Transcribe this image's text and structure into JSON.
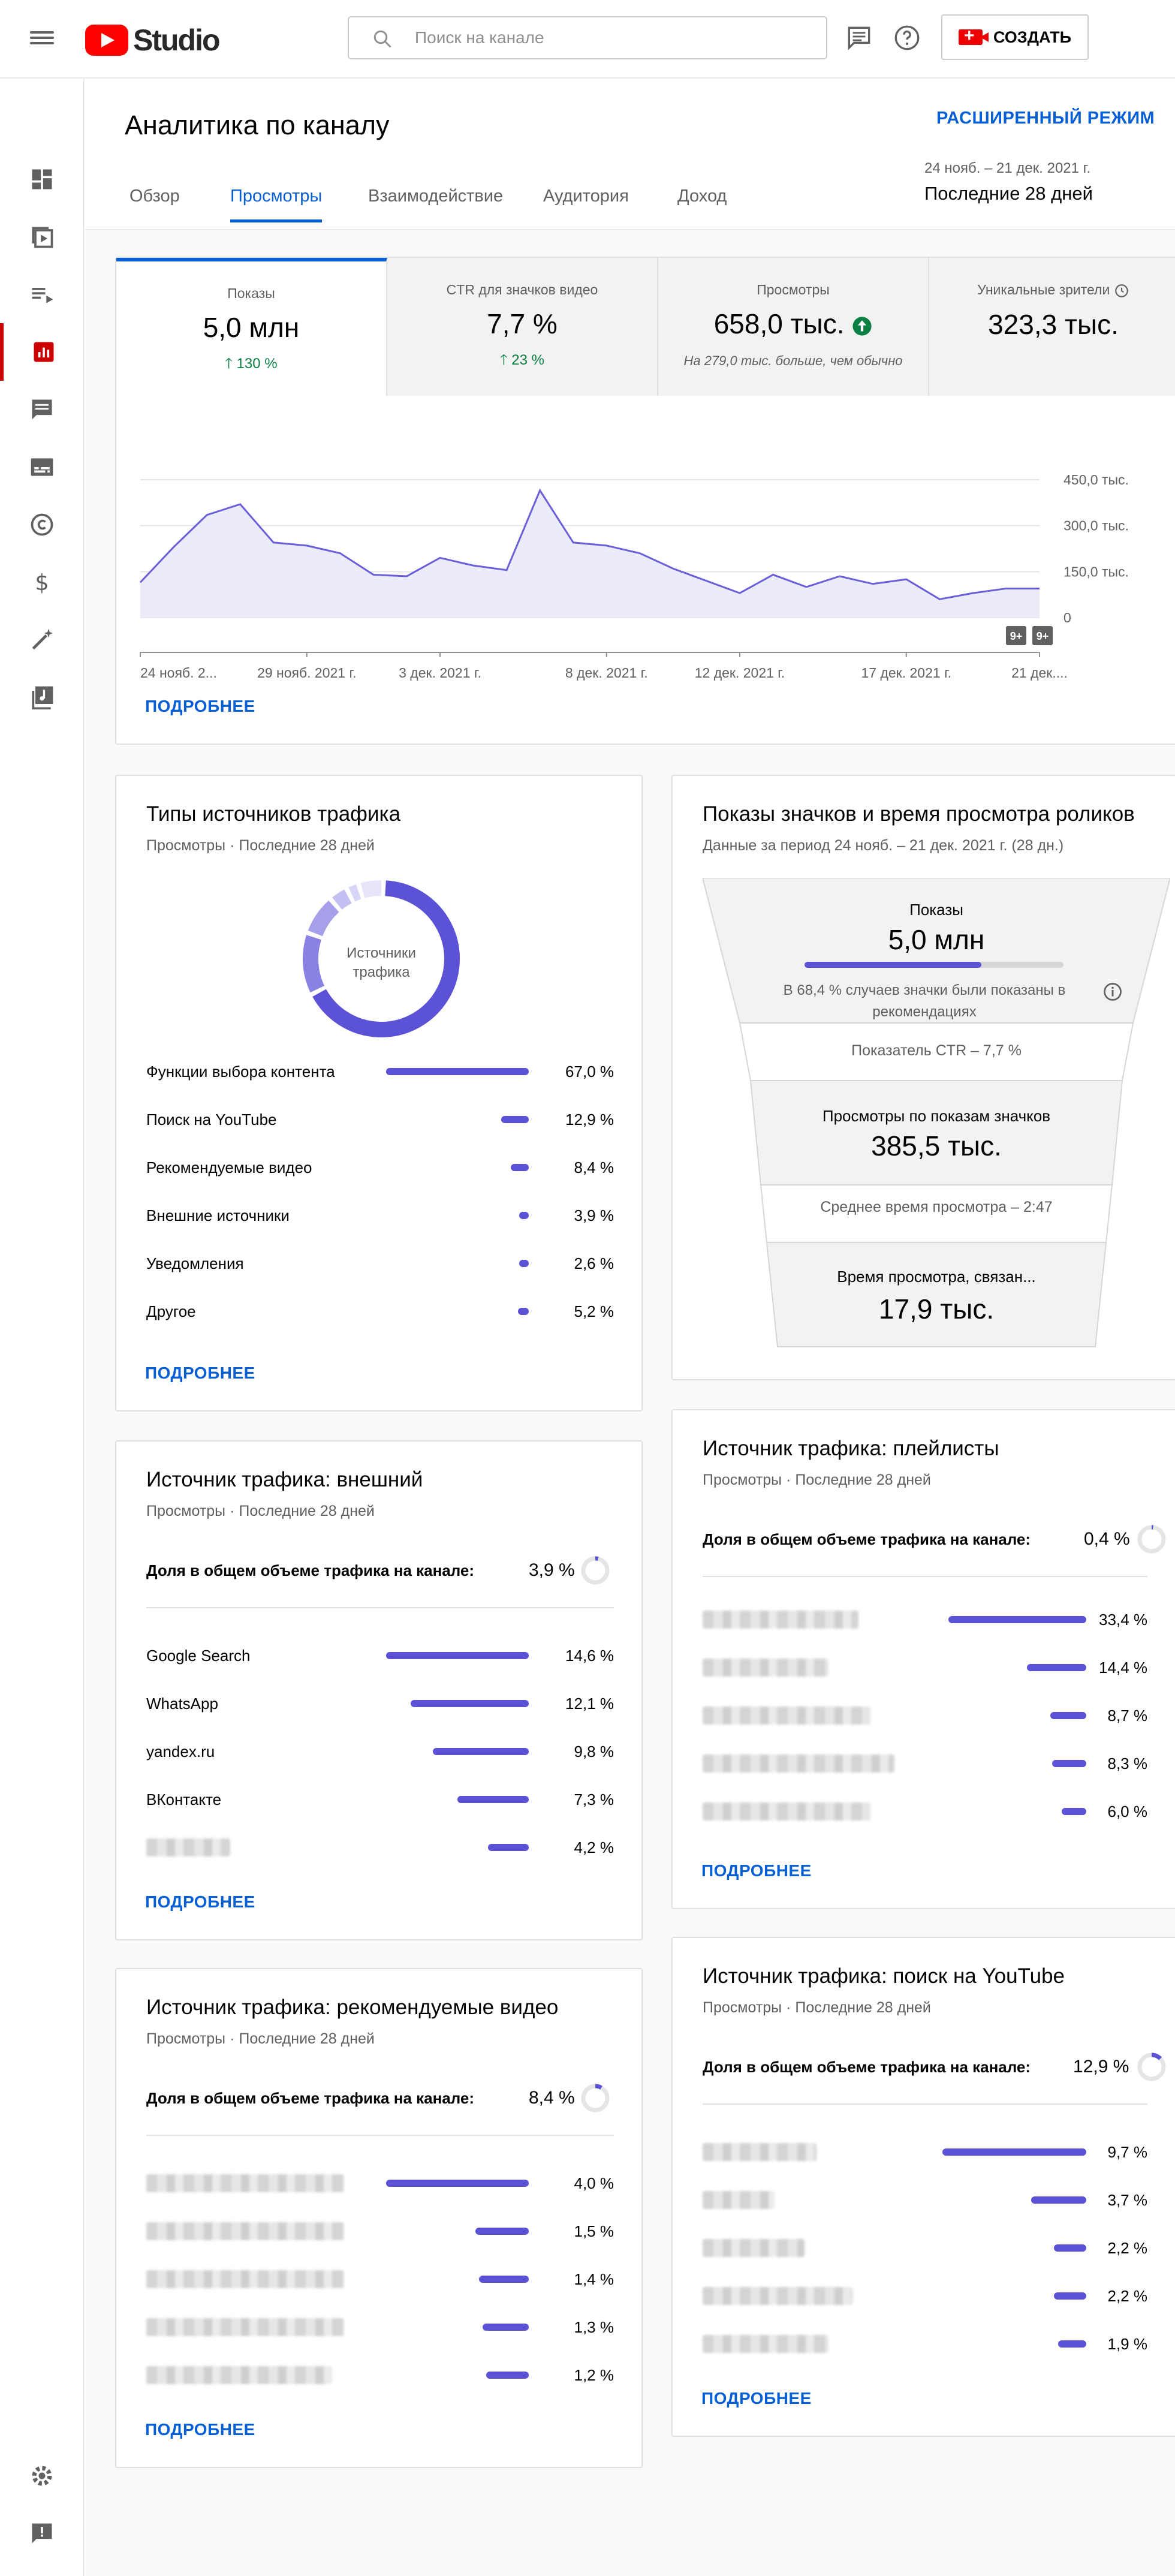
{
  "app": {
    "title": "Studio",
    "search_placeholder": "Поиск на канале",
    "create_label": "СОЗДАТЬ"
  },
  "page": {
    "title": "Аналитика по каналу",
    "advanced_mode": "РАСШИРЕННЫЙ РЕЖИМ",
    "tabs": [
      "Обзор",
      "Просмотры",
      "Взаимодействие",
      "Аудитория",
      "Доход"
    ],
    "active_tab": "Просмотры",
    "date_range": "24 нояб. – 21 дек. 2021 г.",
    "date_preset": "Последние 28 дней"
  },
  "sidebar": {
    "items": [
      "dashboard-icon",
      "content-icon",
      "playlists-icon",
      "analytics-icon",
      "comments-icon",
      "subtitles-icon",
      "copyright-icon",
      "monetization-icon",
      "customization-icon",
      "audio-library-icon",
      "settings-icon",
      "feedback-icon"
    ],
    "active": "analytics-icon"
  },
  "metrics": [
    {
      "label": "Показы",
      "value": "5,0 млн",
      "delta": "130 %"
    },
    {
      "label": "CTR для значков видео",
      "value": "7,7 %",
      "delta": "23 %"
    },
    {
      "label": "Просмотры",
      "value": "658,0 тыс.",
      "note": "На 279,0 тыс. больше, чем обычно"
    },
    {
      "label": "Уникальные зрители",
      "value": "323,3 тыс."
    }
  ],
  "chart_data": {
    "type": "area",
    "title": "",
    "x_ticks": [
      "24 нояб. 2...",
      "29 нояб. 2021 г.",
      "3 дек. 2021 г.",
      "8 дек. 2021 г.",
      "12 дек. 2021 г.",
      "17 дек. 2021 г.",
      "21 дек...."
    ],
    "y_ticks": [
      "450,0 тыс.",
      "300,0 тыс.",
      "150,0 тыс.",
      "0"
    ],
    "ylim": [
      0,
      450000
    ],
    "badges": [
      "9+",
      "9+"
    ],
    "x": [
      "24.11",
      "25.11",
      "26.11",
      "27.11",
      "28.11",
      "29.11",
      "30.11",
      "01.12",
      "02.12",
      "03.12",
      "04.12",
      "05.12",
      "06.12",
      "07.12",
      "08.12",
      "09.12",
      "10.12",
      "11.12",
      "12.12",
      "13.12",
      "14.12",
      "15.12",
      "16.12",
      "17.12",
      "18.12",
      "19.12",
      "20.12",
      "21.12"
    ],
    "values": [
      115000,
      230000,
      335000,
      370000,
      245000,
      235000,
      210000,
      140000,
      135000,
      195000,
      170000,
      155000,
      415000,
      245000,
      235000,
      210000,
      160000,
      120000,
      80000,
      140000,
      100000,
      135000,
      110000,
      125000,
      60000,
      80000,
      95000,
      95000
    ],
    "more": "ПОДРОБНЕЕ"
  },
  "traffic_types": {
    "title": "Типы источников трафика",
    "subtitle": "Просмотры · Последние 28 дней",
    "donut_label": "Источники трафика",
    "rows": [
      {
        "label": "Функции выбора контента",
        "value": "67,0 %",
        "share": 67.0
      },
      {
        "label": "Поиск на YouTube",
        "value": "12,9 %",
        "share": 12.9
      },
      {
        "label": "Рекомендуемые видео",
        "value": "8,4 %",
        "share": 8.4
      },
      {
        "label": "Внешние источники",
        "value": "3,9 %",
        "share": 3.9
      },
      {
        "label": "Уведомления",
        "value": "2,6 %",
        "share": 2.6
      },
      {
        "label": "Другое",
        "value": "5,2 %",
        "share": 5.2
      }
    ],
    "more": "ПОДРОБНЕЕ"
  },
  "funnel": {
    "title": "Показы значков и время просмотра роликов",
    "subtitle": "Данные за период 24 нояб. – 21 дек. 2021 г. (28 дн.)",
    "impressions_label": "Показы",
    "impressions_value": "5,0 млн",
    "impressions_share": 68.4,
    "impressions_note": "В 68,4 % случаев значки были показаны в рекомендациях",
    "ctr_text": "Показатель CTR – 7,7 %",
    "views_label": "Просмотры по показам значков",
    "views_value": "385,5 тыс.",
    "avg_text": "Среднее время просмотра – 2:47",
    "watch_label": "Время просмотра, связан...",
    "watch_value": "17,9 тыс."
  },
  "external": {
    "title": "Источник трафика: внешний",
    "subtitle": "Просмотры · Последние 28 дней",
    "share_label": "Доля в общем объеме трафика на канале:",
    "share_value": "3,9 %",
    "rows": [
      {
        "label": "Google Search",
        "value": "14,6 %",
        "share": 14.6
      },
      {
        "label": "WhatsApp",
        "value": "12,1 %",
        "share": 12.1
      },
      {
        "label": "yandex.ru",
        "value": "9,8 %",
        "share": 9.8
      },
      {
        "label": "ВКонтакте",
        "value": "7,3 %",
        "share": 7.3
      },
      {
        "label": "",
        "value": "4,2 %",
        "share": 4.2
      }
    ],
    "more": "ПОДРОБНЕЕ"
  },
  "playlists": {
    "title": "Источник трафика: плейлисты",
    "subtitle": "Просмотры · Последние 28 дней",
    "share_label": "Доля в общем объеме трафика на канале:",
    "share_value": "0,4 %",
    "rows": [
      {
        "value": "33,4 %",
        "share": 33.4
      },
      {
        "value": "14,4 %",
        "share": 14.4
      },
      {
        "value": "8,7 %",
        "share": 8.7
      },
      {
        "value": "8,3 %",
        "share": 8.3
      },
      {
        "value": "6,0 %",
        "share": 6.0
      }
    ],
    "more": "ПОДРОБНЕЕ"
  },
  "suggested": {
    "title": "Источник трафика: рекомендуемые видео",
    "subtitle": "Просмотры · Последние 28 дней",
    "share_label": "Доля в общем объеме трафика на канале:",
    "share_value": "8,4 %",
    "rows": [
      {
        "value": "4,0 %",
        "share": 4.0
      },
      {
        "value": "1,5 %",
        "share": 1.5
      },
      {
        "value": "1,4 %",
        "share": 1.4
      },
      {
        "value": "1,3 %",
        "share": 1.3
      },
      {
        "value": "1,2 %",
        "share": 1.2
      }
    ],
    "more": "ПОДРОБНЕЕ"
  },
  "yt_search": {
    "title": "Источник трафика: поиск на YouTube",
    "subtitle": "Просмотры · Последние 28 дней",
    "share_label": "Доля в общем объеме трафика на канале:",
    "share_value": "12,9 %",
    "rows": [
      {
        "value": "9,7 %",
        "share": 9.7
      },
      {
        "value": "3,7 %",
        "share": 3.7
      },
      {
        "value": "2,2 %",
        "share": 2.2
      },
      {
        "value": "2,2 %",
        "share": 2.2
      },
      {
        "value": "1,9 %",
        "share": 1.9
      }
    ],
    "more": "ПОДРОБНЕЕ"
  },
  "colors": {
    "accent": "#065fd4",
    "bar": "#5c52d6",
    "chart_line": "#6a5fd8",
    "chart_fill": "#ecebf8",
    "red": "#cc0000",
    "green": "#0b8043"
  }
}
